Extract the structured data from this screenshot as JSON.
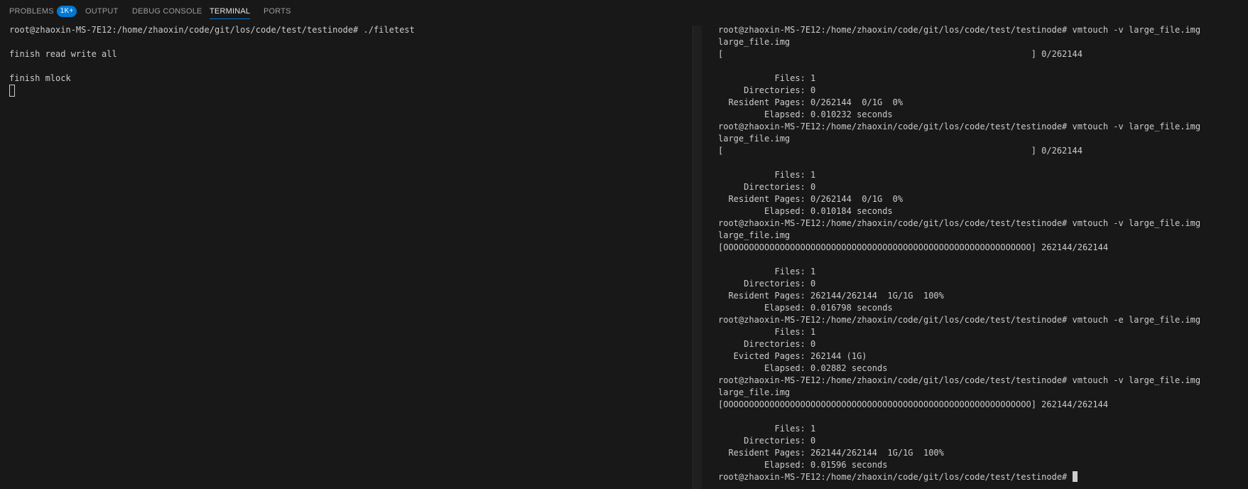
{
  "panel": {
    "tabs": [
      {
        "label": "PROBLEMS",
        "badge": "1K+",
        "active": false
      },
      {
        "label": "OUTPUT",
        "active": false
      },
      {
        "label": "DEBUG CONSOLE",
        "active": false
      },
      {
        "label": "TERMINAL",
        "active": true
      },
      {
        "label": "PORTS",
        "active": false
      }
    ]
  },
  "terminal_left": {
    "lines": [
      "root@zhaoxin-MS-7E12:/home/zhaoxin/code/git/los/code/test/testinode# ./filetest",
      "",
      "finish read write all",
      "",
      "finish mlock"
    ]
  },
  "terminal_right": {
    "lines": [
      "root@zhaoxin-MS-7E12:/home/zhaoxin/code/git/los/code/test/testinode# vmtouch -v large_file.img",
      "large_file.img",
      "[                                                            ] 0/262144",
      "",
      "           Files: 1",
      "     Directories: 0",
      "  Resident Pages: 0/262144  0/1G  0%",
      "         Elapsed: 0.010232 seconds",
      "root@zhaoxin-MS-7E12:/home/zhaoxin/code/git/los/code/test/testinode# vmtouch -v large_file.img",
      "large_file.img",
      "[                                                            ] 0/262144",
      "",
      "           Files: 1",
      "     Directories: 0",
      "  Resident Pages: 0/262144  0/1G  0%",
      "         Elapsed: 0.010184 seconds",
      "root@zhaoxin-MS-7E12:/home/zhaoxin/code/git/los/code/test/testinode# vmtouch -v large_file.img",
      "large_file.img",
      "[OOOOOOOOOOOOOOOOOOOOOOOOOOOOOOOOOOOOOOOOOOOOOOOOOOOOOOOOOOOO] 262144/262144",
      "",
      "           Files: 1",
      "     Directories: 0",
      "  Resident Pages: 262144/262144  1G/1G  100%",
      "         Elapsed: 0.016798 seconds",
      "root@zhaoxin-MS-7E12:/home/zhaoxin/code/git/los/code/test/testinode# vmtouch -e large_file.img",
      "           Files: 1",
      "     Directories: 0",
      "   Evicted Pages: 262144 (1G)",
      "         Elapsed: 0.02882 seconds",
      "root@zhaoxin-MS-7E12:/home/zhaoxin/code/git/los/code/test/testinode# vmtouch -v large_file.img",
      "large_file.img",
      "[OOOOOOOOOOOOOOOOOOOOOOOOOOOOOOOOOOOOOOOOOOOOOOOOOOOOOOOOOOOO] 262144/262144",
      "",
      "           Files: 1",
      "     Directories: 0",
      "  Resident Pages: 262144/262144  1G/1G  100%",
      "         Elapsed: 0.01596 seconds"
    ],
    "prompt": "root@zhaoxin-MS-7E12:/home/zhaoxin/code/git/los/code/test/testinode# "
  },
  "colors": {
    "background": "#181818",
    "text": "#cccccc",
    "accent": "#0078d4"
  }
}
